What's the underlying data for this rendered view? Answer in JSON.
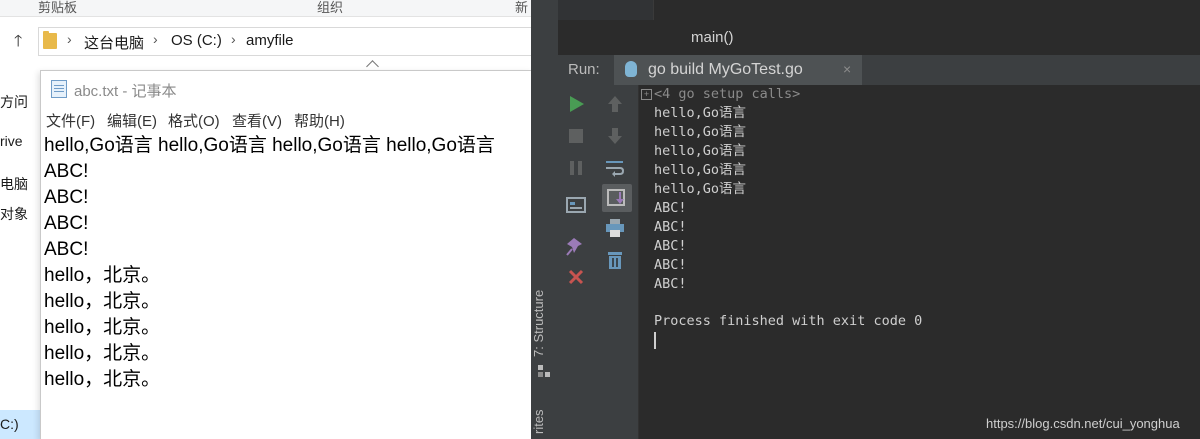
{
  "explorer": {
    "ribbon": {
      "clipboard": "剪贴板",
      "organize": "组织",
      "new_frag": "新"
    },
    "breadcrumb": [
      "这台电脑",
      "OS (C:)",
      "amyfile"
    ],
    "nav_fragments": [
      "方问",
      "rive",
      "电脑",
      "对象"
    ],
    "drive_fragment": "C:)"
  },
  "notepad": {
    "title": "abc.txt - 记事本",
    "menu": [
      "文件(F)",
      "编辑(E)",
      "格式(O)",
      "查看(V)",
      "帮助(H)"
    ],
    "lines": [
      "hello,Go语言 hello,Go语言 hello,Go语言 hello,Go语言",
      "ABC!",
      "ABC!",
      "ABC!",
      "ABC!",
      "hello，北京。",
      "hello，北京。",
      "hello，北京。",
      "hello，北京。",
      "hello，北京。"
    ]
  },
  "ide": {
    "breadcrumb_func": "main()",
    "run_label": "Run:",
    "run_tab": "go build MyGoTest.go",
    "run_tab_close": "×",
    "console": {
      "setup_calls": "<4 go setup calls>",
      "lines": [
        "hello,Go语言",
        "hello,Go语言",
        "hello,Go语言",
        "hello,Go语言",
        "hello,Go语言",
        "ABC!",
        "ABC!",
        "ABC!",
        "ABC!",
        "ABC!"
      ],
      "exit_message": "Process finished with exit code 0"
    },
    "side_labels": {
      "structure": "7: Structure",
      "favorites_frag": "rites"
    },
    "accent_green": "#499c54",
    "accent_red": "#c75450"
  },
  "watermark": "https://blog.csdn.net/cui_yonghua"
}
